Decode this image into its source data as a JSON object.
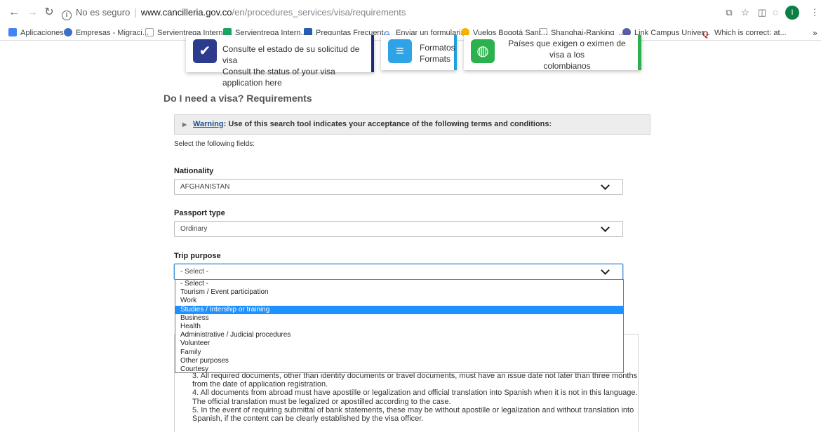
{
  "browser": {
    "security_label": "No es seguro",
    "url_domain": "www.cancilleria.gov.co",
    "url_path": "/en/procedures_services/visa/requirements",
    "profile_initial": "I",
    "bookmarks": [
      {
        "label": "Aplicaciones",
        "color": "#4285f4"
      },
      {
        "label": "Empresas - Migraci...",
        "color": "#3b6fc9"
      },
      {
        "label": "Servientrega Intern...",
        "color": "#9aa0a6"
      },
      {
        "label": "Servientrega Intern...",
        "color": "#1ea362"
      },
      {
        "label": "Preguntas Frecuent...",
        "color": "#2a5db0"
      },
      {
        "label": "Enviar un formulari...",
        "color": "#ea4335"
      },
      {
        "label": "Vuelos Bogotá Sant...",
        "color": "#f4b400"
      },
      {
        "label": "Shanghai-Ranking_...",
        "color": "#9aa0a6"
      },
      {
        "label": "Link Campus Univer...",
        "color": "#5b5ea6"
      },
      {
        "label": "Which is correct: at...",
        "color": "#b92b27"
      }
    ],
    "more_bookmarks": "»"
  },
  "cards": {
    "status": {
      "line1": "Consulte el estado de su solicitud de visa",
      "line2": "Consult the status of your visa application here",
      "icon": "clipboard-check-icon"
    },
    "formats": {
      "line1": "Formatos",
      "line2": "Formats",
      "icon": "document-icon"
    },
    "countries": {
      "line1": "Países que exigen o eximen de visa a los",
      "line2": "colombianos",
      "icon": "globe-icon"
    }
  },
  "page": {
    "title": "Do I need a visa? Requirements",
    "warning_link": "Warning",
    "warning_text": ": Use of this search tool indicates your acceptance of the following terms and conditions:",
    "hint": "Select the following fields:"
  },
  "form": {
    "nationality": {
      "label": "Nationality",
      "value": "AFGHANISTAN"
    },
    "passport": {
      "label": "Passport type",
      "value": "Ordinary"
    },
    "purpose": {
      "label": "Trip purpose",
      "value": "- Select -",
      "options": [
        "- Select -",
        "Tourism / Event participation",
        "Work",
        "Studies / Intership or training",
        "Business",
        "Health",
        "Administrative / Judicial procedures",
        "Volunteer",
        "Family",
        "Other purposes",
        "Courtesy"
      ],
      "highlighted_option": "Studies / Intership or training"
    }
  },
  "notes": [
    "3. All required documents, other than identity documents or travel documents, must have an issue date not later than three months",
    "from the date of application registration.",
    "4. All documents from abroad must have apostille or legalization and official translation into Spanish when it is not in this language.",
    "The official translation must be legalized or apostilled according to the case.",
    "5. In the event of requiring submittal of bank statements, these may be without apostille or legalization and without translation into",
    "Spanish, if the content can be clearly established by the visa officer."
  ]
}
